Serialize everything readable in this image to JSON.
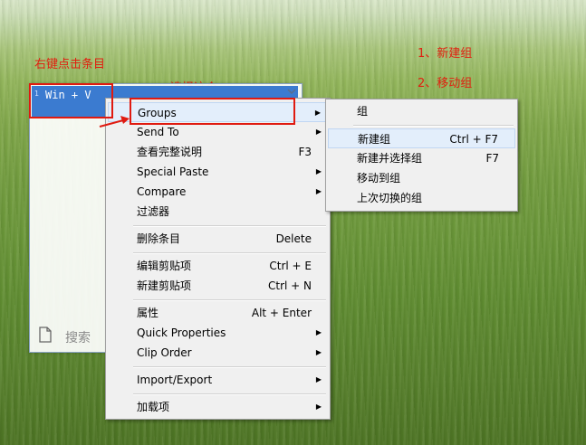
{
  "annotations": {
    "right_click_item": "右键点击条目",
    "choose_this": "选择这个",
    "step1": "1、新建组",
    "step2": "2、移动组"
  },
  "clipboard_window": {
    "item_number": "1",
    "item_text": "Win + V",
    "dropdown_icon": "chevron-down-icon",
    "search_icon": "document-icon",
    "search_label": "搜索"
  },
  "context_menu": {
    "items": [
      {
        "label": "Groups",
        "shortcut": "",
        "submenu": true
      },
      {
        "label": "Send To",
        "shortcut": "",
        "submenu": true
      },
      {
        "label": "查看完整说明",
        "shortcut": "F3",
        "submenu": false
      },
      {
        "label": "Special Paste",
        "shortcut": "",
        "submenu": true
      },
      {
        "label": "Compare",
        "shortcut": "",
        "submenu": true
      },
      {
        "label": "过滤器",
        "shortcut": "",
        "submenu": false
      },
      {
        "label": "删除条目",
        "shortcut": "Delete",
        "submenu": false
      },
      {
        "label": "编辑剪贴项",
        "shortcut": "Ctrl + E",
        "submenu": false
      },
      {
        "label": "新建剪贴项",
        "shortcut": "Ctrl + N",
        "submenu": false
      },
      {
        "label": "属性",
        "shortcut": "Alt + Enter",
        "submenu": false
      },
      {
        "label": "Quick Properties",
        "shortcut": "",
        "submenu": true
      },
      {
        "label": "Clip Order",
        "shortcut": "",
        "submenu": true
      },
      {
        "label": "Import/Export",
        "shortcut": "",
        "submenu": true
      },
      {
        "label": "加载项",
        "shortcut": "",
        "submenu": true
      }
    ]
  },
  "groups_submenu": {
    "items": [
      {
        "label": "组",
        "shortcut": ""
      },
      {
        "label": "新建组",
        "shortcut": "Ctrl + F7"
      },
      {
        "label": "新建并选择组",
        "shortcut": "F7"
      },
      {
        "label": "移动到组",
        "shortcut": ""
      },
      {
        "label": "上次切换的组",
        "shortcut": ""
      }
    ]
  },
  "colors": {
    "annotation_red": "#e02010",
    "selection_blue": "#3b7bd0",
    "menu_bg": "#f0f0f0",
    "menu_highlight": "#e3eefb"
  }
}
